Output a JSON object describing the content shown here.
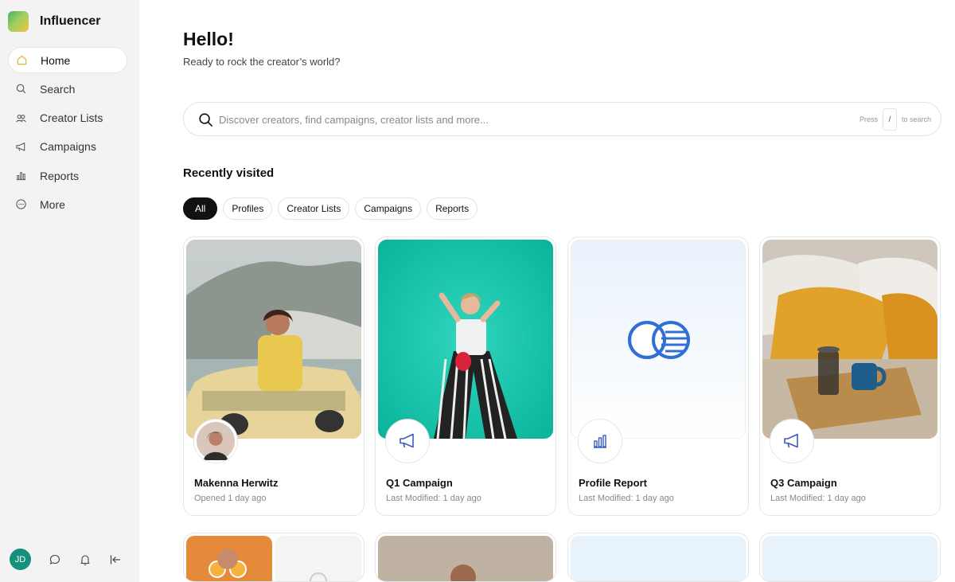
{
  "brand": {
    "name": "Influencer"
  },
  "sidebar": {
    "items": [
      {
        "label": "Home"
      },
      {
        "label": "Search"
      },
      {
        "label": "Creator Lists"
      },
      {
        "label": "Campaigns"
      },
      {
        "label": "Reports"
      },
      {
        "label": "More"
      }
    ],
    "user_initials": "JD"
  },
  "header": {
    "title": "Hello!",
    "subtitle": "Ready to rock the creator’s world?"
  },
  "search": {
    "placeholder": "Discover creators, find campaigns, creator lists and more...",
    "hint_press": "Press",
    "hint_key": "/",
    "hint_action": "to search"
  },
  "recent": {
    "title": "Recently visited",
    "filters": [
      "All",
      "Profiles",
      "Creator Lists",
      "Campaigns",
      "Reports"
    ],
    "cards": [
      {
        "title": "Makenna Herwitz",
        "meta": "Opened 1 day ago",
        "icon": "profile-avatar"
      },
      {
        "title": "Q1 Campaign",
        "meta": "Last Modified: 1 day ago",
        "icon": "megaphone-icon"
      },
      {
        "title": "Profile Report",
        "meta": "Last Modified: 1 day ago",
        "icon": "bar-chart-icon"
      },
      {
        "title": "Q3 Campaign",
        "meta": "Last Modified: 1 day ago",
        "icon": "megaphone-icon"
      }
    ]
  },
  "colors": {
    "accent": "#2f6fd6",
    "active_chip": "#111111",
    "avatar": "#15907d",
    "sidebar_bg": "#f3f3f3",
    "home_icon": "#e0b53a"
  }
}
